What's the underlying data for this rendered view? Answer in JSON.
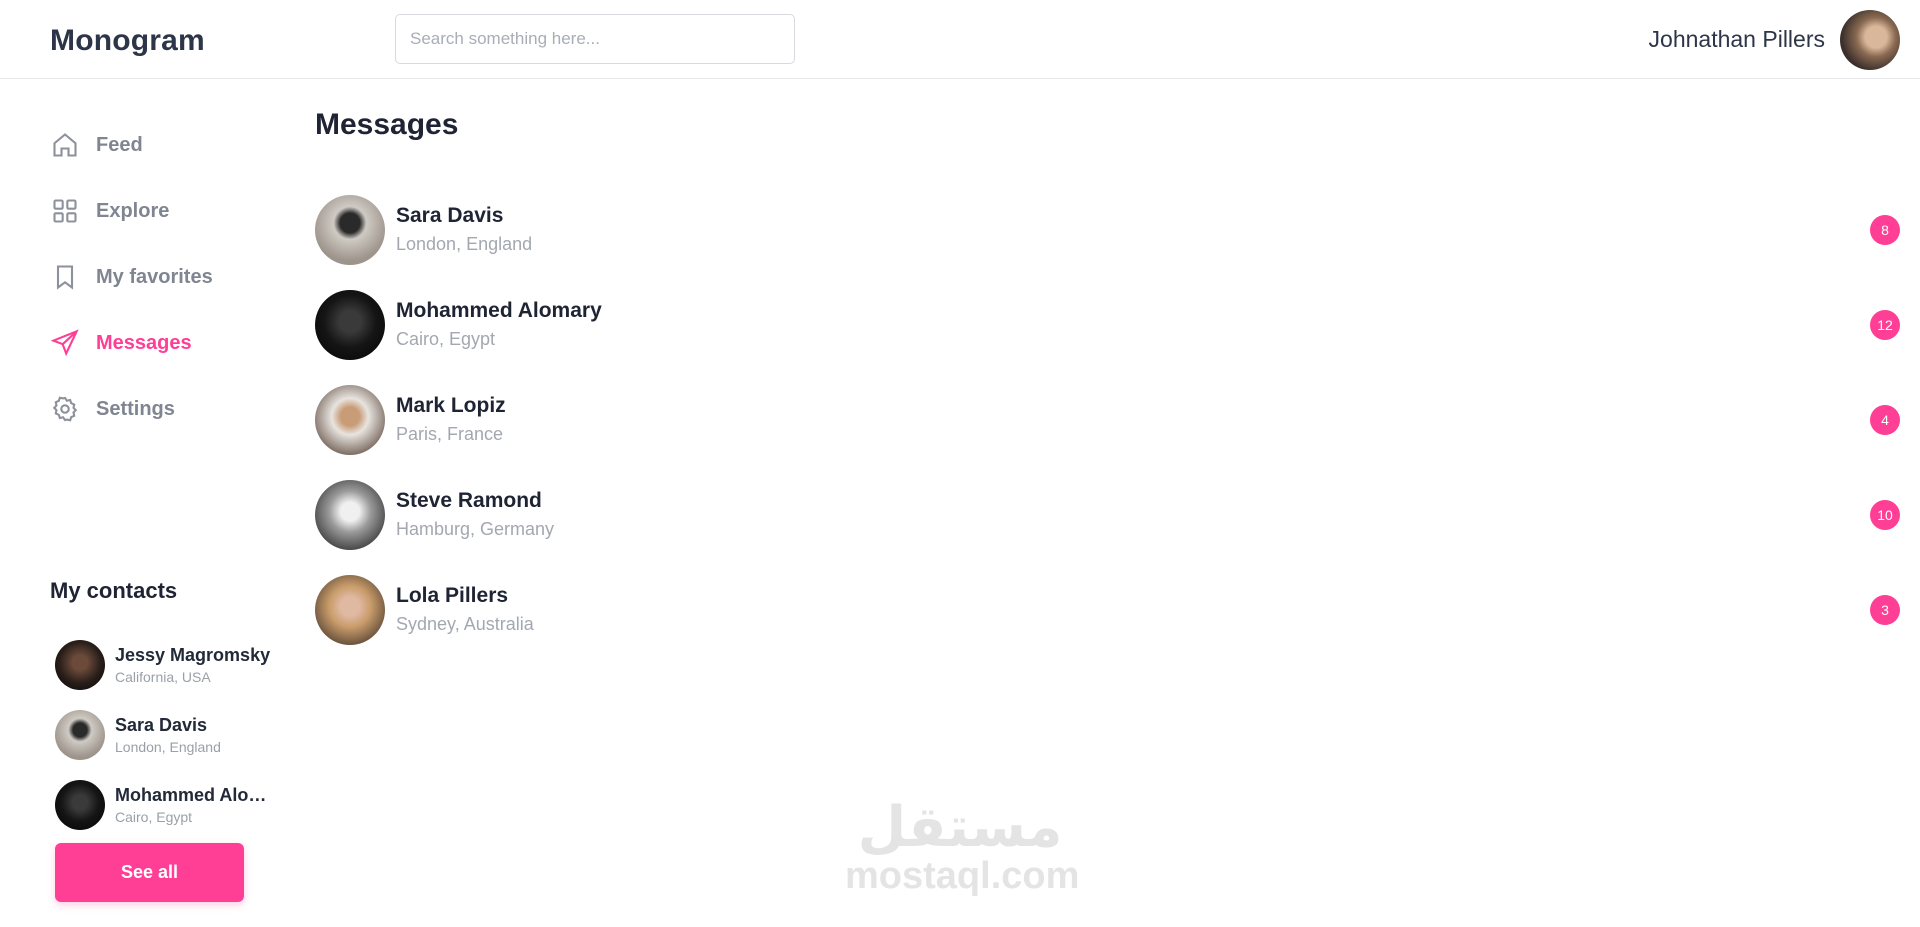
{
  "header": {
    "brand": "Monogram",
    "search_placeholder": "Search something here...",
    "user_name": "Johnathan Pillers"
  },
  "nav": {
    "items": [
      {
        "label": "Feed",
        "icon": "home-icon",
        "active": false
      },
      {
        "label": "Explore",
        "icon": "grid-icon",
        "active": false
      },
      {
        "label": "My favorites",
        "icon": "bookmark-icon",
        "active": false
      },
      {
        "label": "Messages",
        "icon": "send-icon",
        "active": true
      },
      {
        "label": "Settings",
        "icon": "gear-icon",
        "active": false
      }
    ]
  },
  "contacts": {
    "title": "My contacts",
    "items": [
      {
        "name": "Jessy Magromsky",
        "location": "California, USA"
      },
      {
        "name": "Sara Davis",
        "location": "London, England"
      },
      {
        "name": "Mohammed Alomary",
        "location": "Cairo, Egypt"
      }
    ],
    "see_all_label": "See all"
  },
  "messages": {
    "title": "Messages",
    "items": [
      {
        "name": "Sara Davis",
        "location": "London, England",
        "unread": "8"
      },
      {
        "name": "Mohammed Alomary",
        "location": "Cairo, Egypt",
        "unread": "12"
      },
      {
        "name": "Mark Lopiz",
        "location": "Paris, France",
        "unread": "4"
      },
      {
        "name": "Steve Ramond",
        "location": "Hamburg, Germany",
        "unread": "10"
      },
      {
        "name": "Lola Pillers",
        "location": "Sydney, Australia",
        "unread": "3"
      }
    ]
  },
  "watermark": {
    "arabic": "مستقل",
    "latin": "mostaql.com"
  },
  "colors": {
    "accent": "#ff3e95",
    "text_primary": "#1e2433",
    "text_muted": "#a3a8b0",
    "border": "#e6e8ec"
  }
}
